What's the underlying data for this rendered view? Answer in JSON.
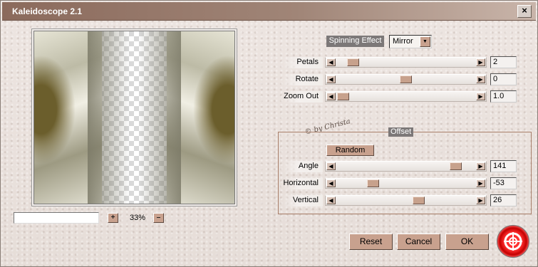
{
  "window": {
    "title": "Kaleidoscope 2.1",
    "close_label": "×"
  },
  "preview": {
    "progress_text": "",
    "zoom_in_label": "+",
    "zoom_out_label": "–",
    "zoom_value": "33%"
  },
  "spinning": {
    "label": "Spinning Effect",
    "value": "Mirror"
  },
  "sliders": {
    "petals": {
      "label": "Petals",
      "value": "2",
      "position": 0.08
    },
    "rotate": {
      "label": "Rotate",
      "value": "0",
      "position": 0.5
    },
    "zoom_out": {
      "label": "Zoom Out",
      "value": "1.0",
      "position": 0.0
    }
  },
  "credit": "© by Christa",
  "offset": {
    "title": "Offset",
    "random_label": "Random",
    "angle": {
      "label": "Angle",
      "value": "141",
      "position": 0.9
    },
    "horizontal": {
      "label": "Horizontal",
      "value": "-53",
      "position": 0.24
    },
    "vertical": {
      "label": "Vertical",
      "value": "26",
      "position": 0.6
    }
  },
  "buttons": {
    "reset": "Reset",
    "cancel": "Cancel",
    "ok": "OK"
  },
  "icons": {
    "logo": "lifebuoy-icon",
    "arrow_left": "arrow-left-icon",
    "arrow_right": "arrow-right-icon"
  },
  "colors": {
    "accent": "#c8a18e",
    "titlebar": "#8b6a5c"
  }
}
